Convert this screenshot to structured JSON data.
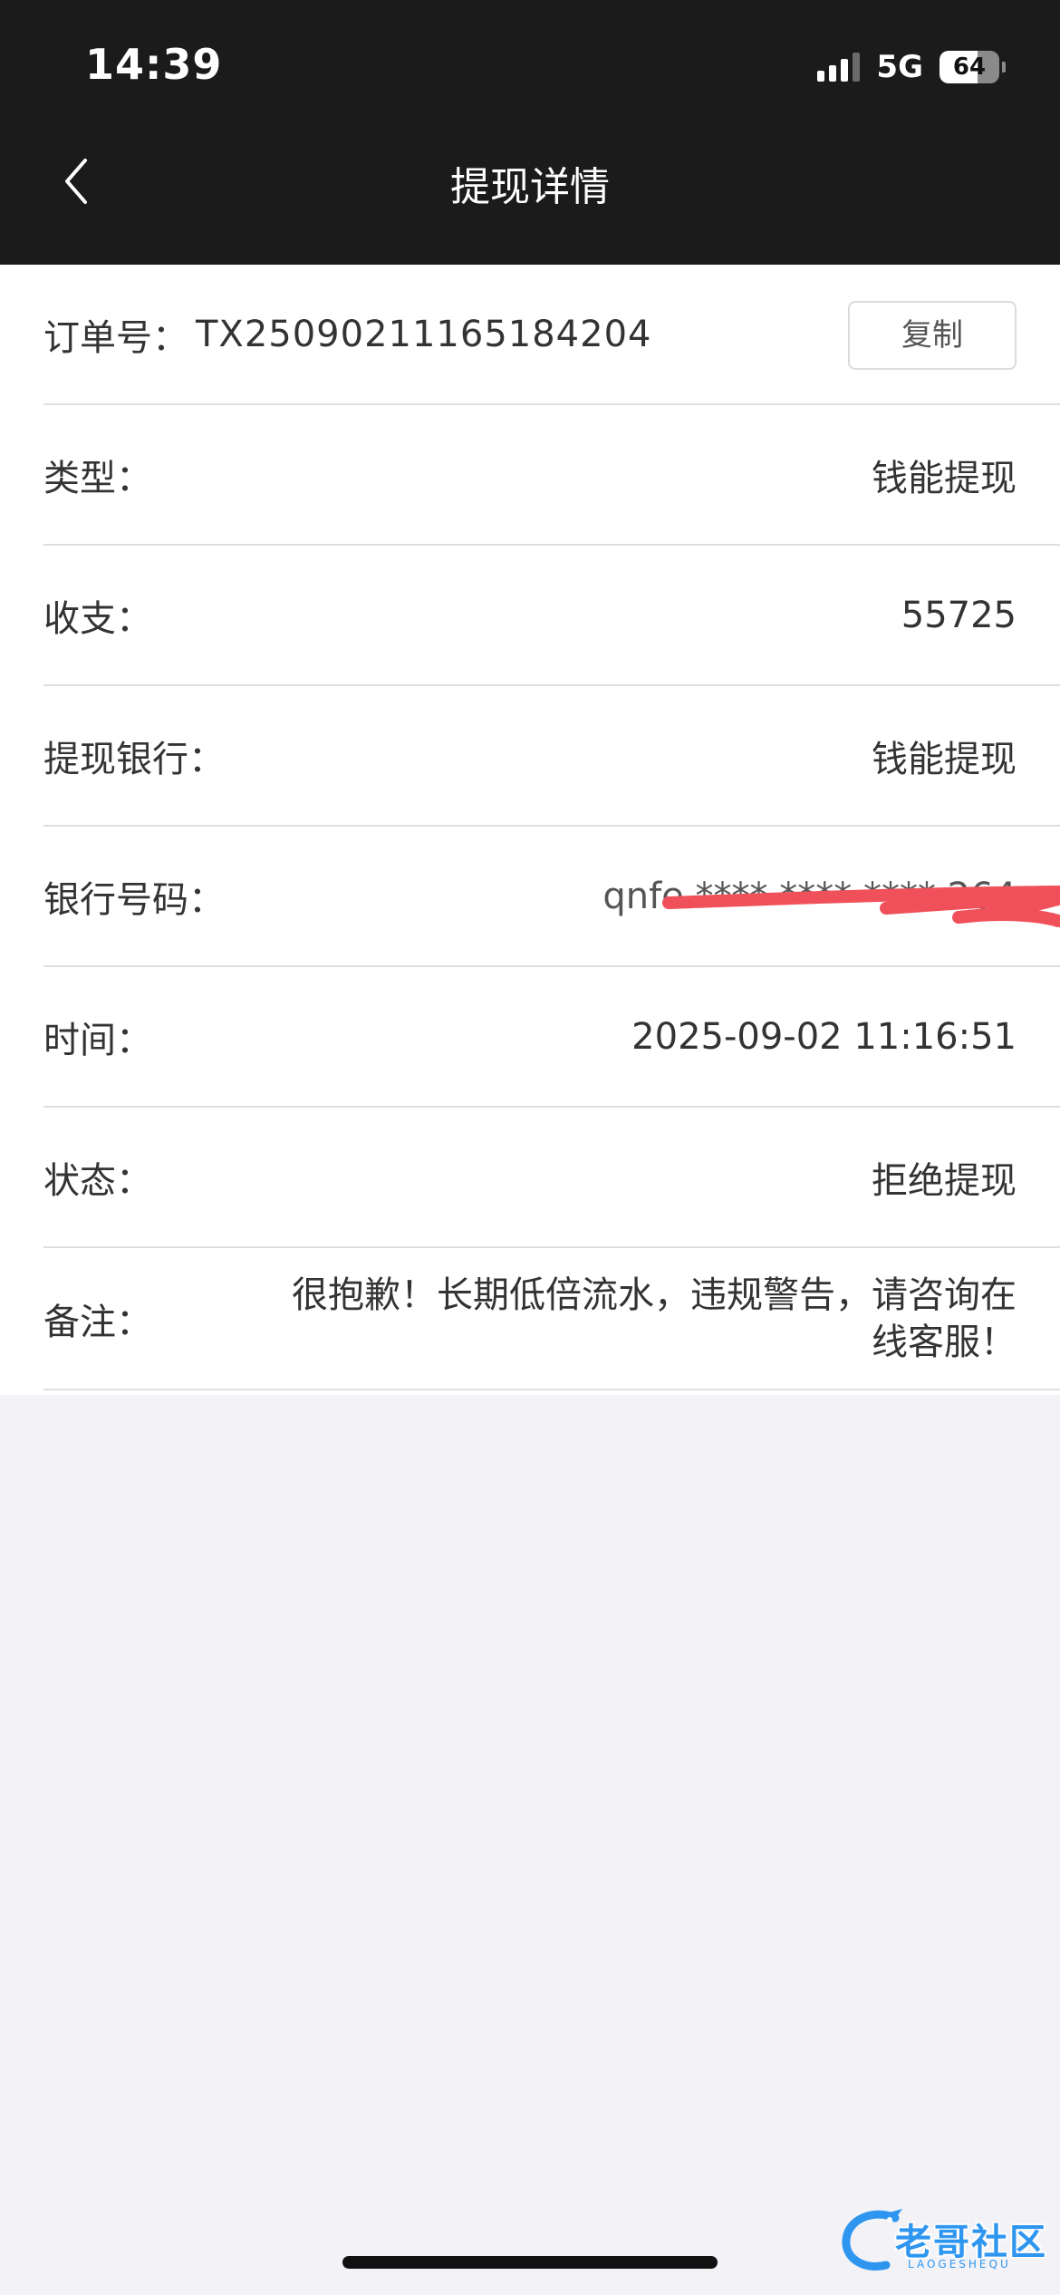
{
  "status_bar": {
    "time": "14:39",
    "network": "5G",
    "battery": "64",
    "battery_level": 0.64
  },
  "nav": {
    "back_icon": "chevron-left-icon",
    "title": "提现详情"
  },
  "order": {
    "label": "订单号：",
    "number": "TX25090211165184204",
    "copy_label": "复制"
  },
  "details": [
    {
      "label": "类型：",
      "value": "钱能提现"
    },
    {
      "label": "收支：",
      "value": "55725"
    },
    {
      "label": "提现银行：",
      "value": "钱能提现"
    },
    {
      "label": "银行号码：",
      "value": "qnfe **** ****  **** 264"
    },
    {
      "label": "时间：",
      "value": "2025-09-02 11:16:51"
    },
    {
      "label": "状态：",
      "value": "拒绝提现"
    }
  ],
  "remark": {
    "label": "备注：",
    "value": "很抱歉！长期低倍流水，违规警告，请咨询在线客服！"
  },
  "watermark": {
    "text": "老哥社区",
    "subtext": "LAOGESHEQU"
  },
  "colors": {
    "header_bg": "#1b1b1b",
    "page_bg": "#f2f2f7",
    "scribble": "#f0505a",
    "watermark": "#1f8ff0"
  }
}
